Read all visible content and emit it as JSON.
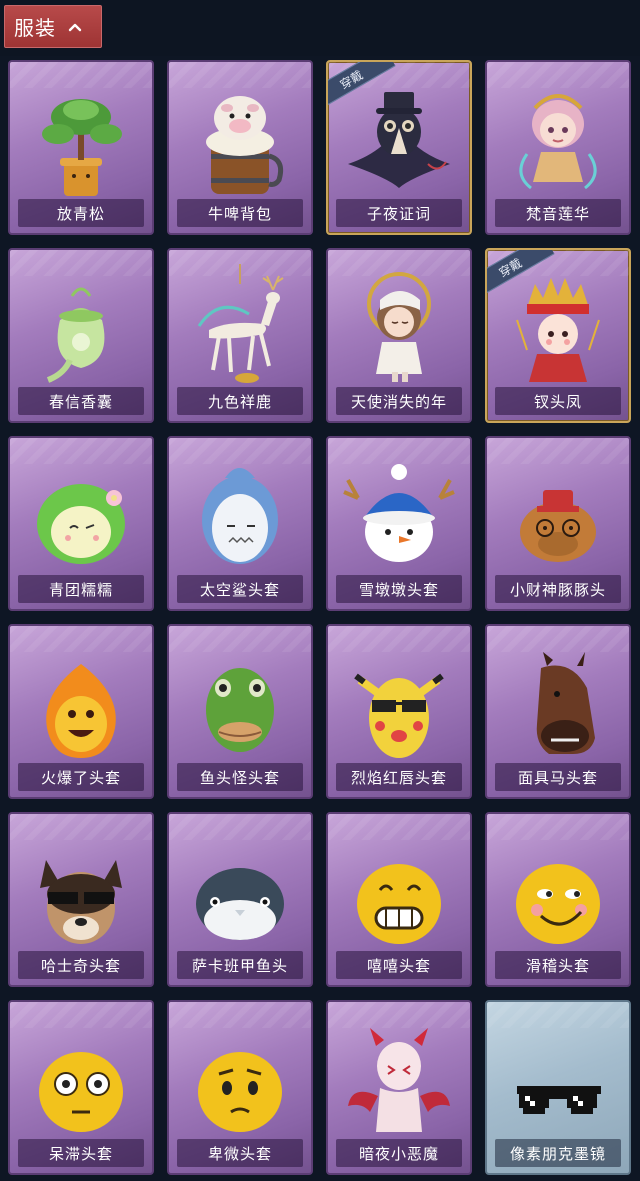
{
  "section": {
    "title": "服装",
    "chevron_icon": "chevron-up-icon"
  },
  "worn_label": "穿戴",
  "items": [
    {
      "name": "放青松",
      "icon": "bonsai-pine-icon",
      "worn": false,
      "style": "purple"
    },
    {
      "name": "牛啤背包",
      "icon": "beer-barrel-backpack-icon",
      "worn": false,
      "style": "purple"
    },
    {
      "name": "子夜证词",
      "icon": "plague-doctor-crow-icon",
      "worn": true,
      "style": "purple"
    },
    {
      "name": "梵音莲华",
      "icon": "fairy-girl-icon",
      "worn": false,
      "style": "purple"
    },
    {
      "name": "春信香囊",
      "icon": "sachet-pouch-icon",
      "worn": false,
      "style": "purple"
    },
    {
      "name": "九色祥鹿",
      "icon": "nine-color-deer-icon",
      "worn": false,
      "style": "purple"
    },
    {
      "name": "天使消失的年",
      "icon": "angel-doll-icon",
      "worn": false,
      "style": "purple"
    },
    {
      "name": "钗头凤",
      "icon": "phoenix-crown-doll-icon",
      "worn": true,
      "style": "purple"
    },
    {
      "name": "青团糯糯",
      "icon": "green-rice-ball-head-icon",
      "worn": false,
      "style": "purple"
    },
    {
      "name": "太空鲨头套",
      "icon": "space-shark-head-icon",
      "worn": false,
      "style": "purple"
    },
    {
      "name": "雪墩墩头套",
      "icon": "snowman-head-icon",
      "worn": false,
      "style": "purple"
    },
    {
      "name": "小财神豚豚头",
      "icon": "capybara-head-icon",
      "worn": false,
      "style": "purple"
    },
    {
      "name": "火爆了头套",
      "icon": "fire-head-icon",
      "worn": false,
      "style": "purple"
    },
    {
      "name": "鱼头怪头套",
      "icon": "fish-head-icon",
      "worn": false,
      "style": "purple"
    },
    {
      "name": "烈焰红唇头套",
      "icon": "pikachu-mask-icon",
      "worn": false,
      "style": "purple"
    },
    {
      "name": "面具马头套",
      "icon": "horse-head-icon",
      "worn": false,
      "style": "purple"
    },
    {
      "name": "哈士奇头套",
      "icon": "husky-head-icon",
      "worn": false,
      "style": "purple"
    },
    {
      "name": "萨卡班甲鱼头",
      "icon": "sacabambaspis-head-icon",
      "worn": false,
      "style": "purple"
    },
    {
      "name": "嘻嘻头套",
      "icon": "grin-emoji-head-icon",
      "worn": false,
      "style": "purple"
    },
    {
      "name": "滑稽头套",
      "icon": "smirk-emoji-head-icon",
      "worn": false,
      "style": "purple"
    },
    {
      "name": "呆滞头套",
      "icon": "dazed-emoji-head-icon",
      "worn": false,
      "style": "purple"
    },
    {
      "name": "卑微头套",
      "icon": "humble-emoji-head-icon",
      "worn": false,
      "style": "purple"
    },
    {
      "name": "暗夜小恶魔",
      "icon": "little-devil-icon",
      "worn": false,
      "style": "purple"
    },
    {
      "name": "像素朋克墨镜",
      "icon": "pixel-sunglasses-icon",
      "worn": false,
      "style": "blue"
    }
  ],
  "colors": {
    "background": "#0e1624",
    "tab": "#a83a3a",
    "card_purple": "#a37cbd",
    "card_blue": "#a4bccd",
    "worn_border": "#c9a55a"
  }
}
